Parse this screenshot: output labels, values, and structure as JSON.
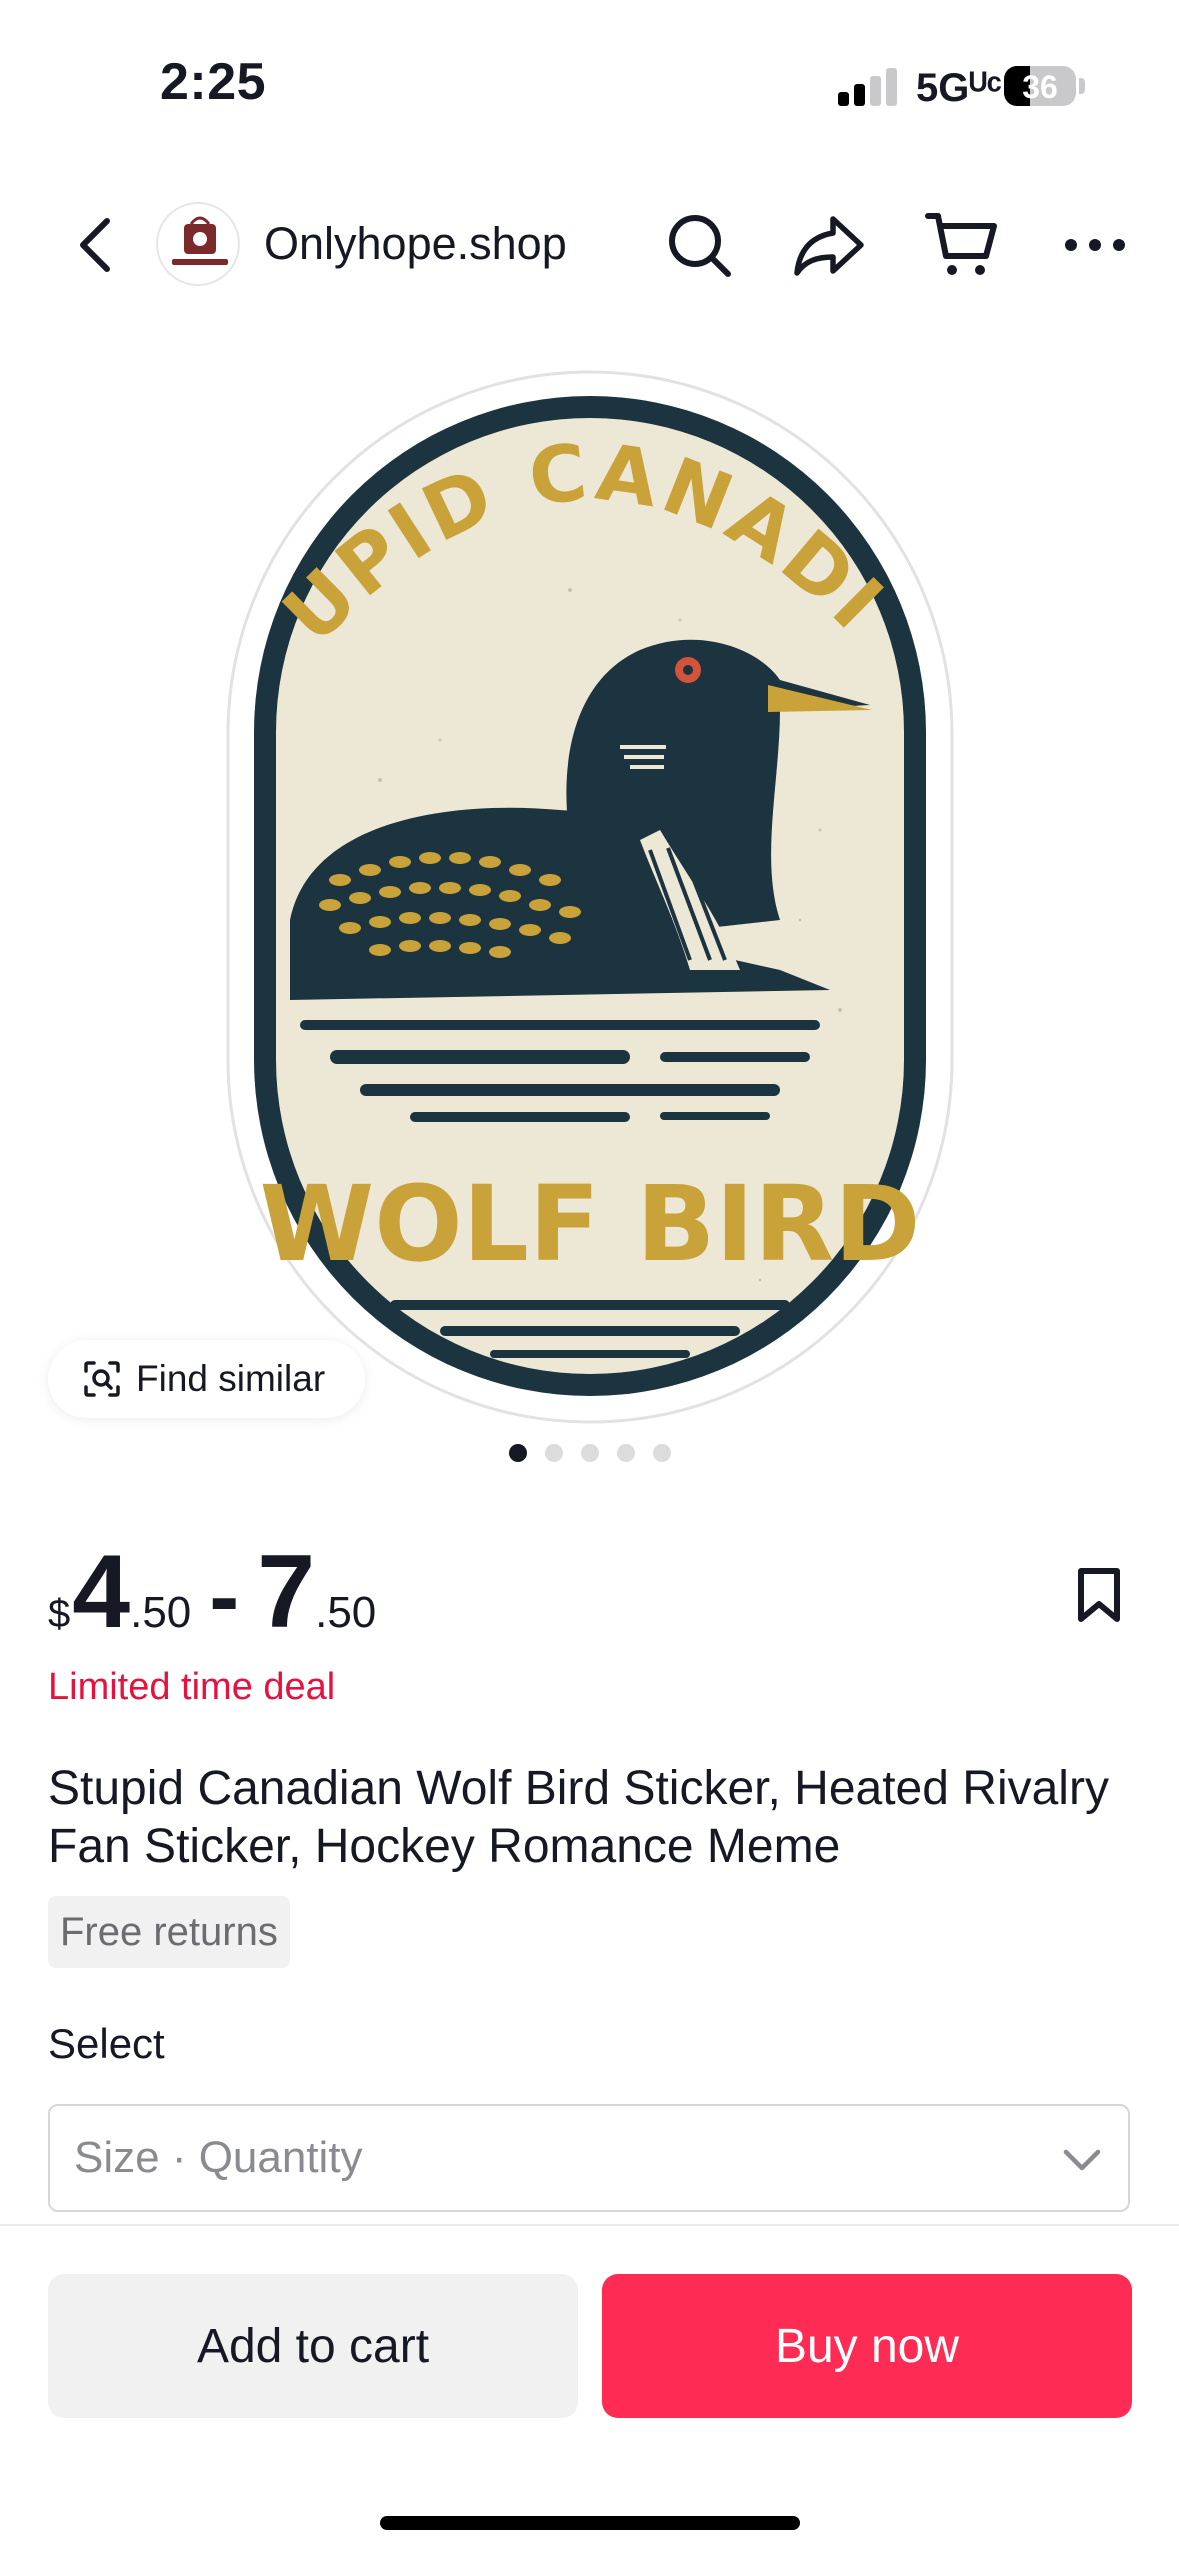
{
  "status_bar": {
    "time": "2:25",
    "network": "5Gᵁᶜ",
    "battery_level": "36",
    "battery_fraction": 0.36
  },
  "nav": {
    "shop_name": "Onlyhope.shop",
    "icons": [
      "back-icon",
      "search-icon",
      "share-icon",
      "cart-icon",
      "more-icon"
    ]
  },
  "gallery": {
    "find_similar_label": "Find similar",
    "image_count": 5,
    "active_index": 0,
    "sticker_text_top": "STUPID CANADIAN",
    "sticker_text_bottom": "WOLF BIRD",
    "colors": {
      "navy": "#1c3340",
      "mustard": "#c9a23a",
      "cream": "#ede7d6",
      "eye": "#d2553b"
    }
  },
  "product": {
    "currency": "$",
    "price_min_int": "4",
    "price_min_dec": ".50",
    "price_separator": "-",
    "price_max_int": "7",
    "price_max_dec": ".50",
    "deal_label": "Limited time deal",
    "title": "Stupid Canadian Wolf Bird Sticker, Heated Rivalry Fan Sticker, Hockey Romance Meme",
    "returns_badge": "Free returns",
    "select_heading": "Select",
    "variant_placeholder": "Size · Quantity"
  },
  "actions": {
    "add_to_cart": "Add to cart",
    "buy_now": "Buy now"
  },
  "theme": {
    "accent": "#fe2c55",
    "deal_red": "#e5123f"
  }
}
